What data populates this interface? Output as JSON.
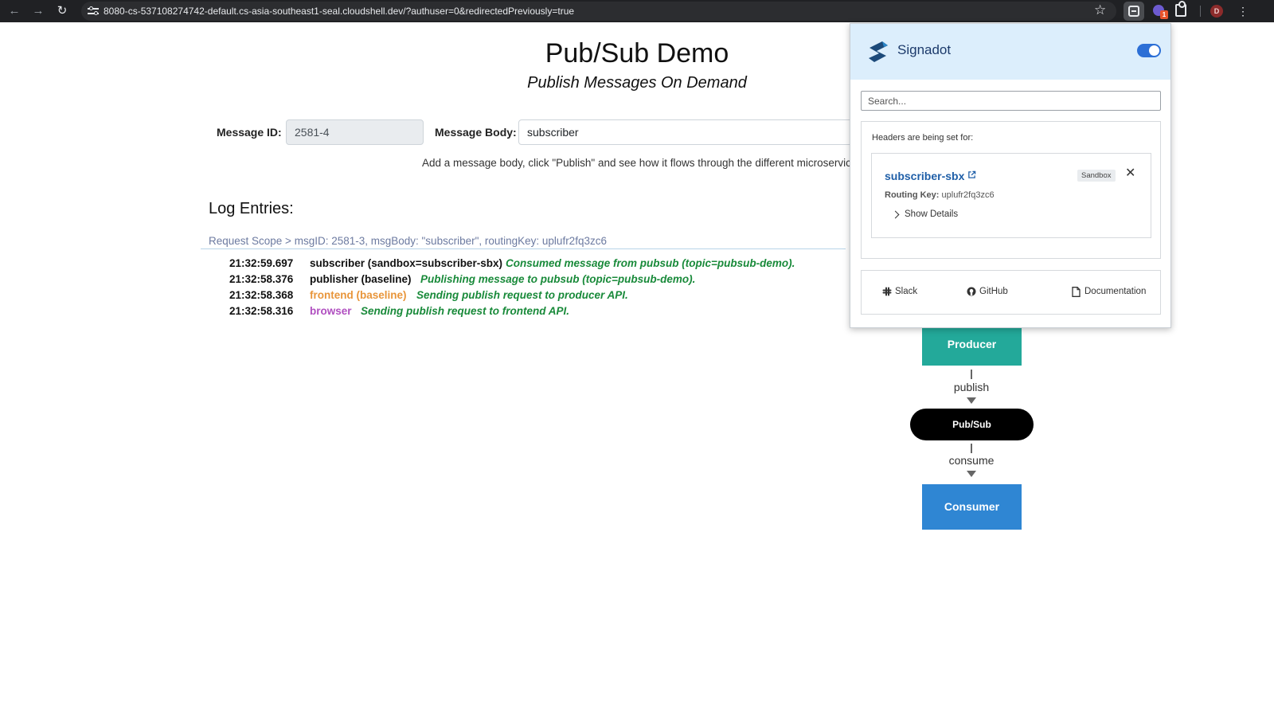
{
  "browser": {
    "url": "8080-cs-537108274742-default.cs-asia-southeast1-seal.cloudshell.dev/?authuser=0&redirectedPreviously=true",
    "icons": [
      "back-icon",
      "forward-icon",
      "reload-icon",
      "site-settings-icon",
      "bookmark-star-icon",
      "signadot-extension-icon",
      "extension-icon",
      "extensions-puzzle-icon",
      "profile-avatar",
      "menu-icon"
    ],
    "extension_badge": "1",
    "profile_initial": "D"
  },
  "page": {
    "title": "Pub/Sub Demo",
    "subtitle": "Publish Messages On Demand",
    "message_id_label": "Message ID:",
    "message_id_value": "2581-4",
    "message_body_label": "Message Body:",
    "message_body_value": "subscriber",
    "help_text": "Add a message body, click \"Publish\" and see how it flows through the different microservic",
    "log_heading": "Log Entries:",
    "request_scope": "Request Scope > msgID: 2581-3, msgBody: \"subscriber\", routingKey: uplufr2fq3zc6",
    "log_entries": [
      {
        "time": "21:32:59.697",
        "service": "subscriber (sandbox=subscriber-sbx)",
        "message": "Consumed message from pubsub (topic=pubsub-demo)."
      },
      {
        "time": "21:32:58.376",
        "service": "publisher (baseline)",
        "message": "Publishing message to pubsub (topic=pubsub-demo)."
      },
      {
        "time": "21:32:58.368",
        "service": "frontend (baseline)",
        "message": "Sending publish request to producer API."
      },
      {
        "time": "21:32:58.316",
        "service": "browser",
        "message": "Sending publish request to frontend API."
      }
    ],
    "colors": {
      "frontend": "#e8953a",
      "browser": "#b04fc0",
      "log_message": "#198a3a",
      "producer": "#23a99a",
      "consumer": "#2f86d3"
    }
  },
  "flow": {
    "producer": "Producer",
    "publish_label": "publish",
    "pubsub": "Pub/Sub",
    "consume_label": "consume",
    "consumer": "Consumer"
  },
  "popup": {
    "brand": "Signadot",
    "toggle_on": true,
    "search_placeholder": "Search...",
    "headers_label": "Headers are being set for:",
    "sandbox_name": "subscriber-sbx",
    "sandbox_tag": "Sandbox",
    "routing_key_label": "Routing Key:",
    "routing_key_value": "uplufr2fq3zc6",
    "show_details": "Show Details",
    "links": {
      "slack": "Slack",
      "github": "GitHub",
      "documentation": "Documentation"
    },
    "accent_color": "#2c6fd6"
  }
}
